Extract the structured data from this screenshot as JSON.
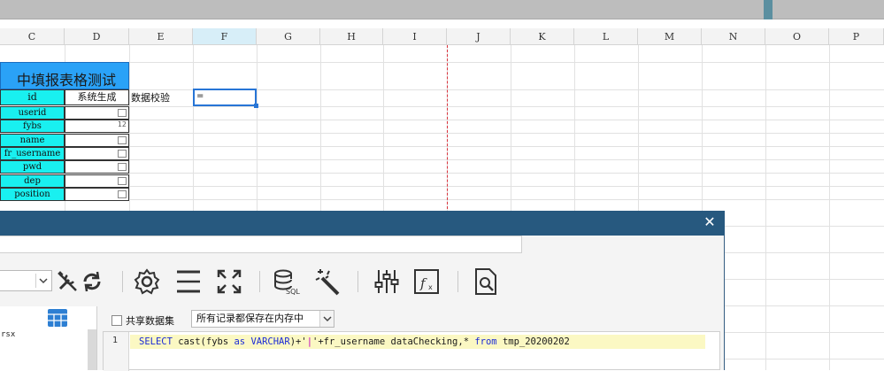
{
  "columns": [
    "C",
    "D",
    "E",
    "F",
    "G",
    "H",
    "I",
    "J",
    "K",
    "L",
    "M",
    "N",
    "O",
    "P"
  ],
  "selected_column": "F",
  "sheet": {
    "title": "中填报表格测试",
    "header_id": "id",
    "header_system": "系统生成",
    "verify_label": "数据校验",
    "active_cell_value": "=",
    "fields": [
      "userid",
      "fybs",
      "name",
      "fr_username",
      "pwd",
      "dep",
      "position"
    ],
    "fybs_value": "12"
  },
  "dialog": {
    "close_symbol": "✕",
    "share_label": "共享数据集",
    "storage_option": "所有记录都保存在内存中",
    "left_item": "rsx",
    "sql": {
      "line_number": "1",
      "tokens": [
        {
          "t": "SELECT ",
          "c": "kw"
        },
        {
          "t": "cast(fybs ",
          "c": "tx"
        },
        {
          "t": "as ",
          "c": "kw"
        },
        {
          "t": "VARCHAR",
          "c": "kw"
        },
        {
          "t": ")+'",
          "c": "tx"
        },
        {
          "t": "|",
          "c": "st"
        },
        {
          "t": "'+fr_username dataChecking,* ",
          "c": "tx"
        },
        {
          "t": "from ",
          "c": "kw"
        },
        {
          "t": "tmp_20200202",
          "c": "tx"
        }
      ]
    }
  },
  "colors": {
    "title_bg": "#2aa2f7",
    "field_bg": "#19f0f0",
    "dialog_title": "#27597f",
    "active_border": "#2775d6",
    "pagebreak": "#d9303a"
  },
  "icons": [
    "tools-icon",
    "refresh-icon",
    "gear-icon",
    "row-height-icon",
    "expand-icon",
    "sql-database-icon",
    "magic-wand-icon",
    "sliders-icon",
    "function-icon",
    "document-search-icon",
    "grid-table-icon"
  ]
}
